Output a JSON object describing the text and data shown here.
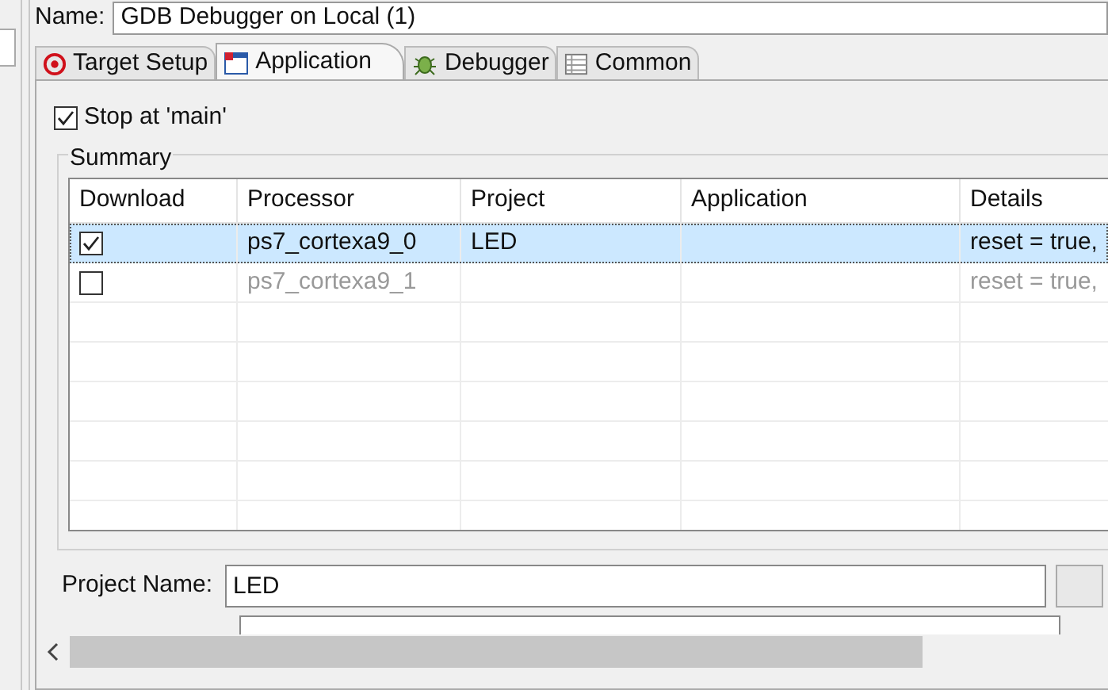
{
  "name_field": {
    "label": "Name:",
    "value": "GDB Debugger on Local (1)"
  },
  "tabs": [
    {
      "label": "Target Setup",
      "kind": "target",
      "selected": false
    },
    {
      "label": "Application",
      "kind": "app",
      "selected": true
    },
    {
      "label": "Debugger",
      "kind": "bug",
      "selected": false
    },
    {
      "label": "Common",
      "kind": "table",
      "selected": false
    }
  ],
  "stop_at_main": {
    "label": "Stop at 'main'",
    "checked": true
  },
  "summary": {
    "title": "Summary",
    "table": {
      "columns": [
        "Download",
        "Processor",
        "Project",
        "Application",
        "Details"
      ],
      "rows": [
        {
          "checked": true,
          "selected": true,
          "enabled": true,
          "cells": [
            "",
            "ps7_cortexa9_0",
            "LED",
            "",
            "reset = true,"
          ]
        },
        {
          "checked": false,
          "selected": false,
          "enabled": false,
          "cells": [
            "",
            "ps7_cortexa9_1",
            "",
            "",
            "reset = true,"
          ]
        }
      ]
    }
  },
  "project_name": {
    "label": "Project Name:",
    "value": "LED"
  }
}
